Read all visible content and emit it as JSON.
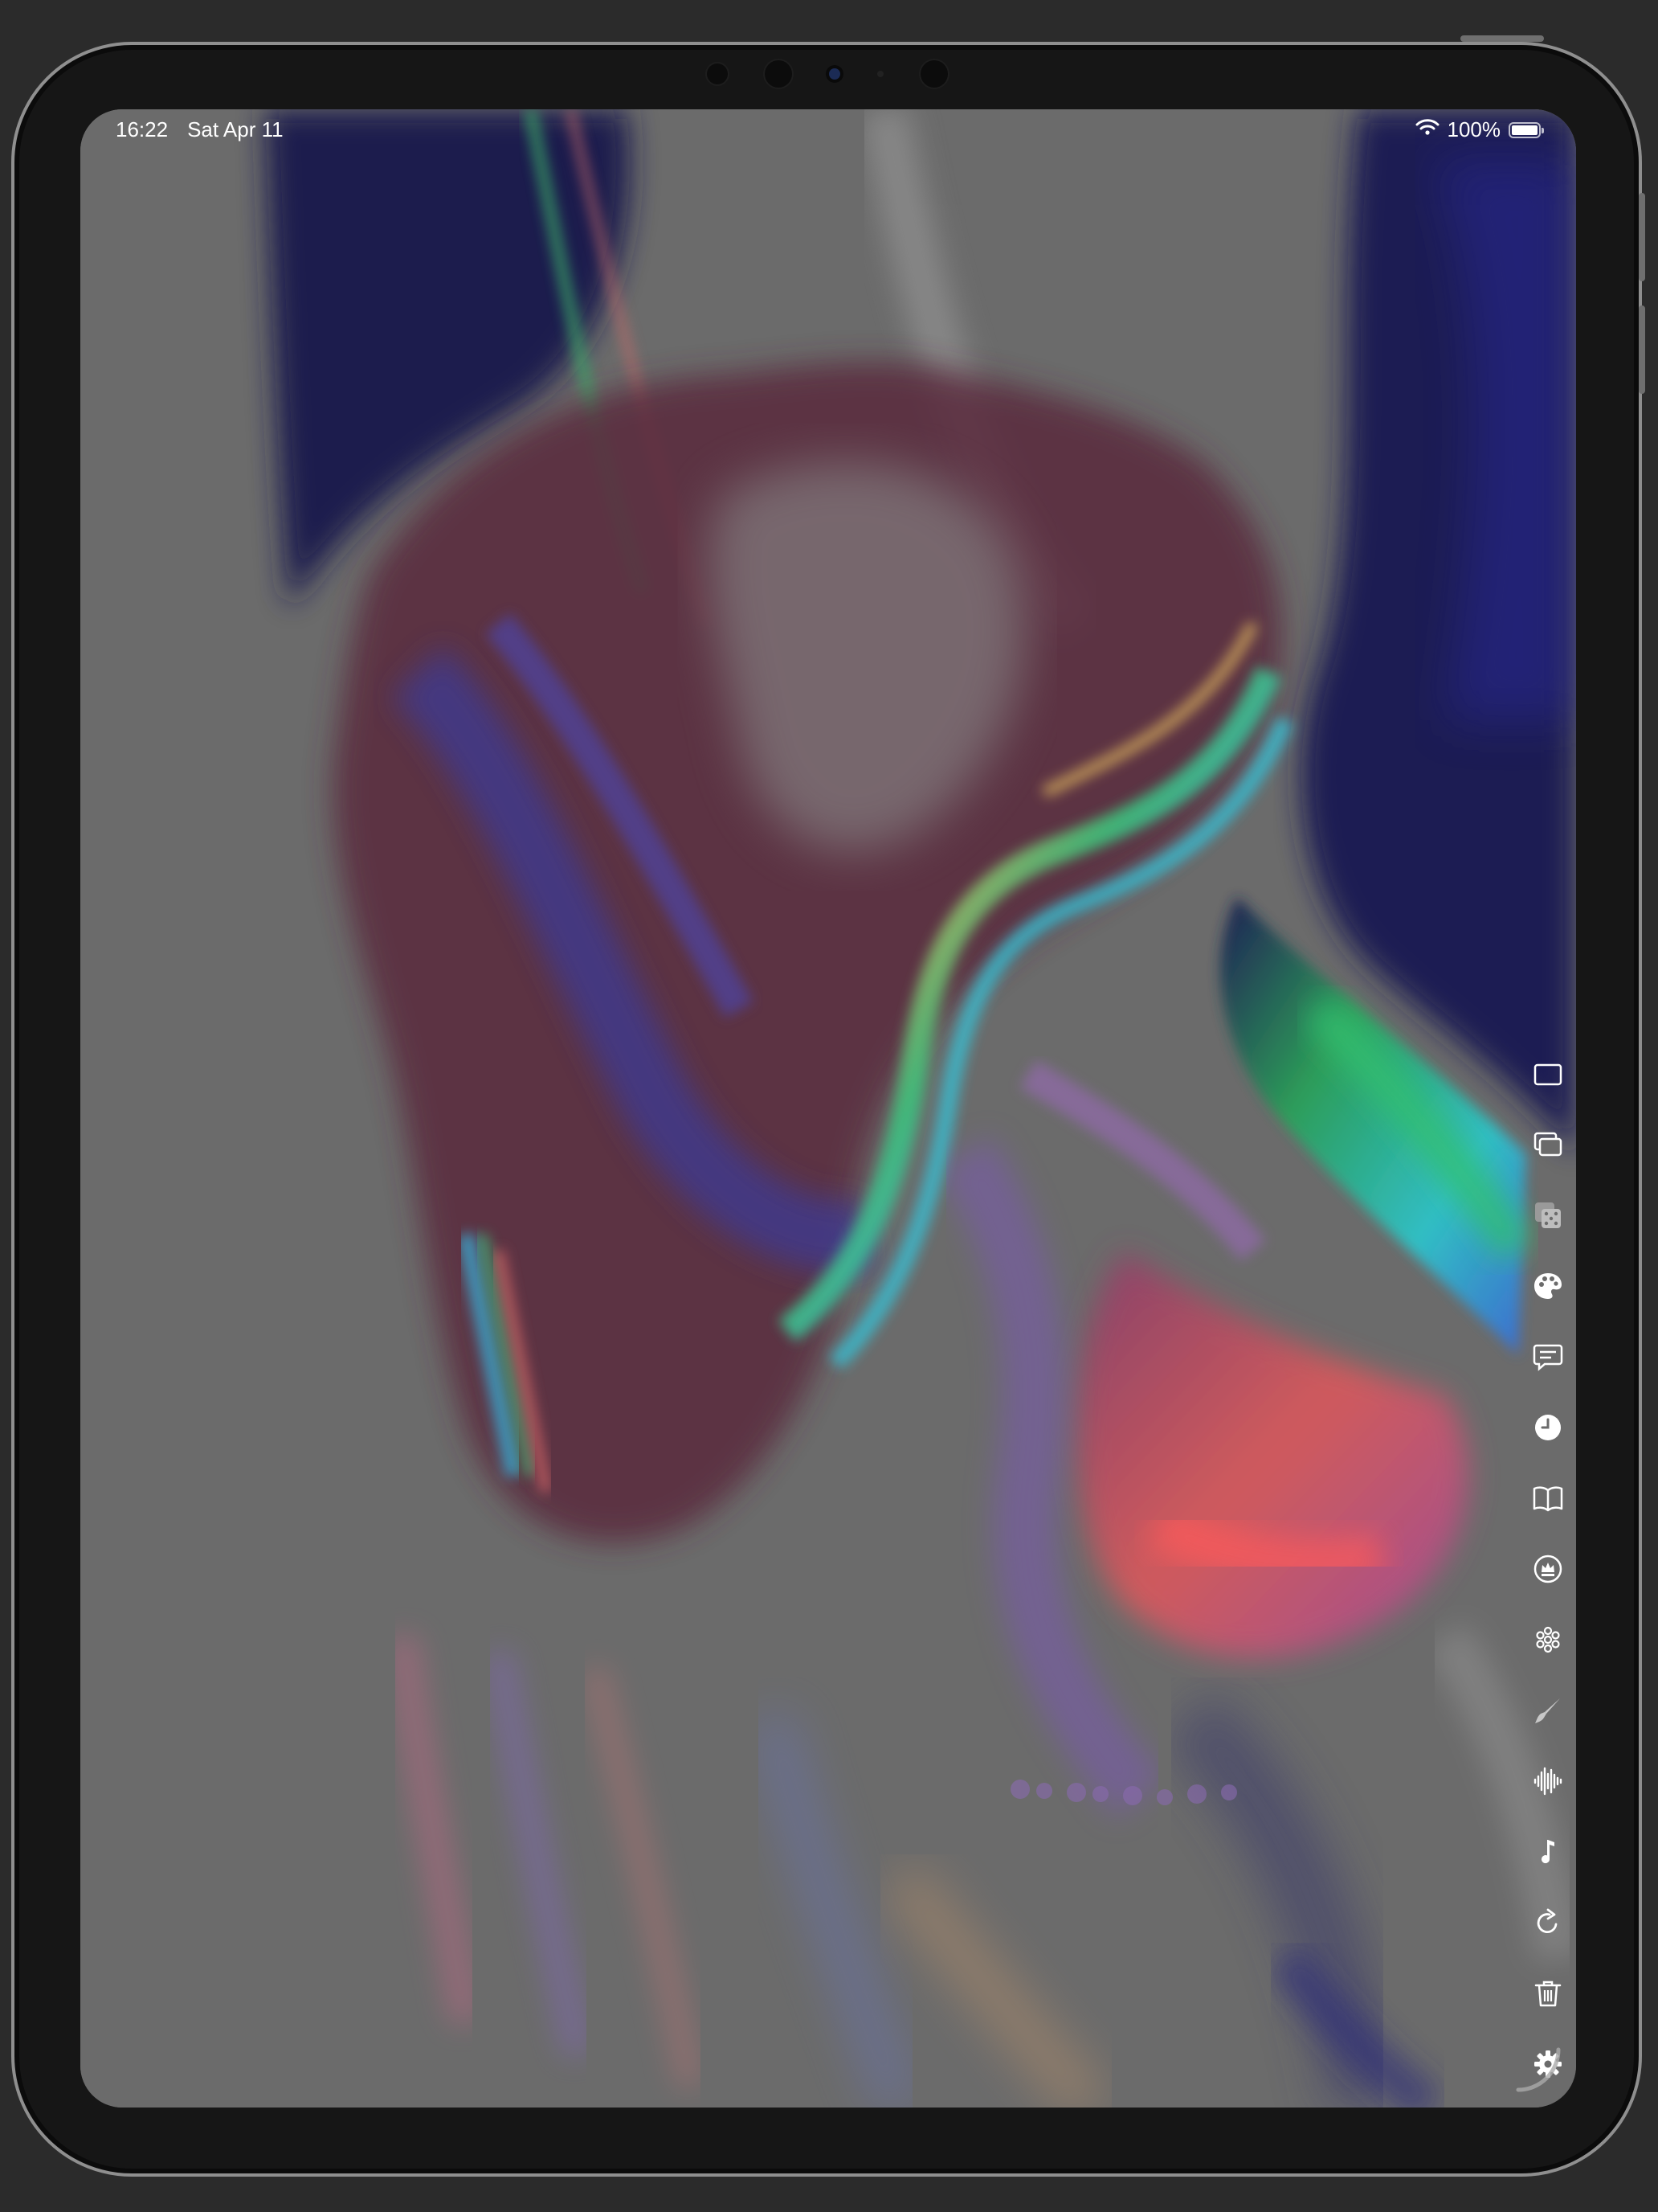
{
  "status_bar": {
    "time": "16:22",
    "date": "Sat Apr 11",
    "battery_percent": "100%",
    "battery_level": 1.0,
    "wifi_icon": "wifi-icon",
    "battery_icon": "battery-icon"
  },
  "toolbar": {
    "items": [
      {
        "name": "single-window-icon"
      },
      {
        "name": "multiple-windows-icon"
      },
      {
        "name": "dice-icon"
      },
      {
        "name": "palette-icon"
      },
      {
        "name": "message-icon"
      },
      {
        "name": "clock-icon"
      },
      {
        "name": "book-icon"
      },
      {
        "name": "crown-circle-icon"
      },
      {
        "name": "flower-icon"
      },
      {
        "name": "paintbrush-icon"
      },
      {
        "name": "waveform-icon"
      },
      {
        "name": "music-note-icon"
      },
      {
        "name": "refresh-icon"
      },
      {
        "name": "trash-icon"
      },
      {
        "name": "gear-icon"
      },
      {
        "name": "close-icon"
      }
    ]
  },
  "colors": {
    "background": "#6b6b6b",
    "deep_blue": "#1c1a4e",
    "maroon": "#6b2a36",
    "teal": "#2fb8c8",
    "green": "#25b06a",
    "pink": "#e0507a",
    "icon": "#ffffff"
  }
}
